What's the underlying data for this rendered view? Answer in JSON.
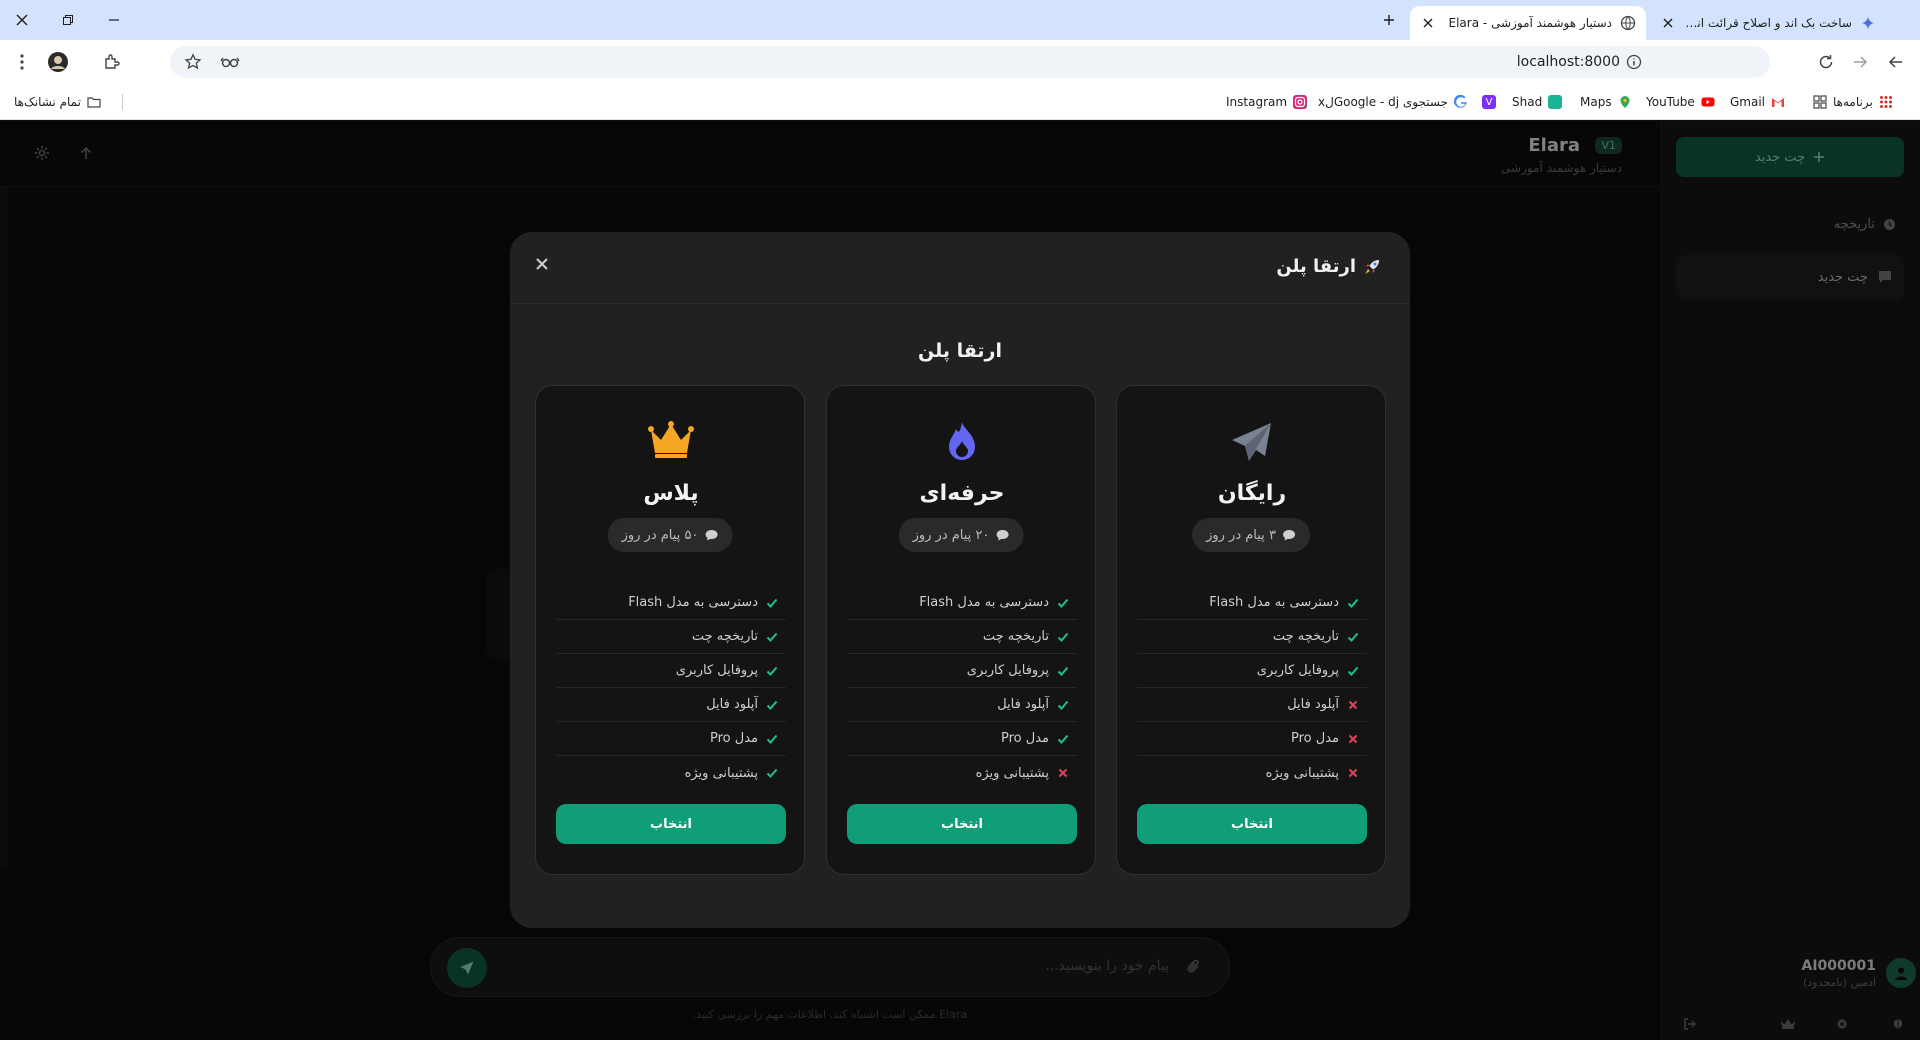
{
  "browser": {
    "tabs": [
      {
        "title": "ساخت بک اند و اصلاح قرائت اند ج"
      },
      {
        "title": "دستیار هوشمند آموزشی - Elara"
      }
    ],
    "url": "localhost:8000",
    "bookmarks": [
      {
        "label": "برنامه‌ها",
        "icon": "apps-icon"
      },
      {
        "label": "Gmail",
        "icon": "gmail-icon"
      },
      {
        "label": "YouTube",
        "icon": "youtube-icon"
      },
      {
        "label": "Maps",
        "icon": "maps-icon"
      },
      {
        "label": "Shad",
        "icon": "shad-icon"
      },
      {
        "label": "",
        "icon": "v-icon"
      },
      {
        "label": "جستجوی Google - djلx",
        "icon": "google-icon"
      },
      {
        "label": "Instagram",
        "icon": "instagram-icon"
      }
    ],
    "all_bookmarks": "تمام نشانک‌ها"
  },
  "sidebar": {
    "new_chat": "چت جدید",
    "history_title": "تاریخچه",
    "history_items": [
      "چت جدید"
    ],
    "user_name": "AI000001",
    "user_role": "ادمین (نامحدود)"
  },
  "header": {
    "title": "Elara",
    "badge": "V1",
    "subtitle": "دستیار هوشمند آموزشی"
  },
  "composer": {
    "placeholder": "پیام خود را بنویسید...",
    "disclaimer": "Elara ممکن است اشتباه کند. اطلاعات مهم را بررسی کنید."
  },
  "modal": {
    "title": "ارتقا پلن",
    "heading": "ارتقا پلن",
    "plans": [
      {
        "name": "رایگان",
        "icon": "paper-plane-icon",
        "messages": "۳ پیام در روز",
        "button": "انتخاب",
        "features": [
          {
            "label": "دسترسی به مدل Flash",
            "included": true
          },
          {
            "label": "تاریخچه چت",
            "included": true
          },
          {
            "label": "پروفایل کاربری",
            "included": true
          },
          {
            "label": "آپلود فایل",
            "included": false
          },
          {
            "label": "مدل Pro",
            "included": false
          },
          {
            "label": "پشتیبانی ویژه",
            "included": false
          }
        ]
      },
      {
        "name": "حرفه‌ای",
        "icon": "fire-icon",
        "messages": "۲۰ پیام در روز",
        "button": "انتخاب",
        "features": [
          {
            "label": "دسترسی به مدل Flash",
            "included": true
          },
          {
            "label": "تاریخچه چت",
            "included": true
          },
          {
            "label": "پروفایل کاربری",
            "included": true
          },
          {
            "label": "آپلود فایل",
            "included": true
          },
          {
            "label": "مدل Pro",
            "included": true
          },
          {
            "label": "پشتیبانی ویژه",
            "included": false
          }
        ]
      },
      {
        "name": "پلاس",
        "icon": "crown-icon",
        "messages": "۵۰ پیام در روز",
        "button": "انتخاب",
        "features": [
          {
            "label": "دسترسی به مدل Flash",
            "included": true
          },
          {
            "label": "تاریخچه چت",
            "included": true
          },
          {
            "label": "پروفایل کاربری",
            "included": true
          },
          {
            "label": "آپلود فایل",
            "included": true
          },
          {
            "label": "مدل Pro",
            "included": true
          },
          {
            "label": "پشتیبانی ویژه",
            "included": true
          }
        ]
      }
    ]
  },
  "colors": {
    "accent": "#0f9e75",
    "check": "#1fbf8f",
    "cross": "#e0425a",
    "crown": "#f5a623",
    "fire": "#6366f1",
    "plane": "#7a8292"
  }
}
